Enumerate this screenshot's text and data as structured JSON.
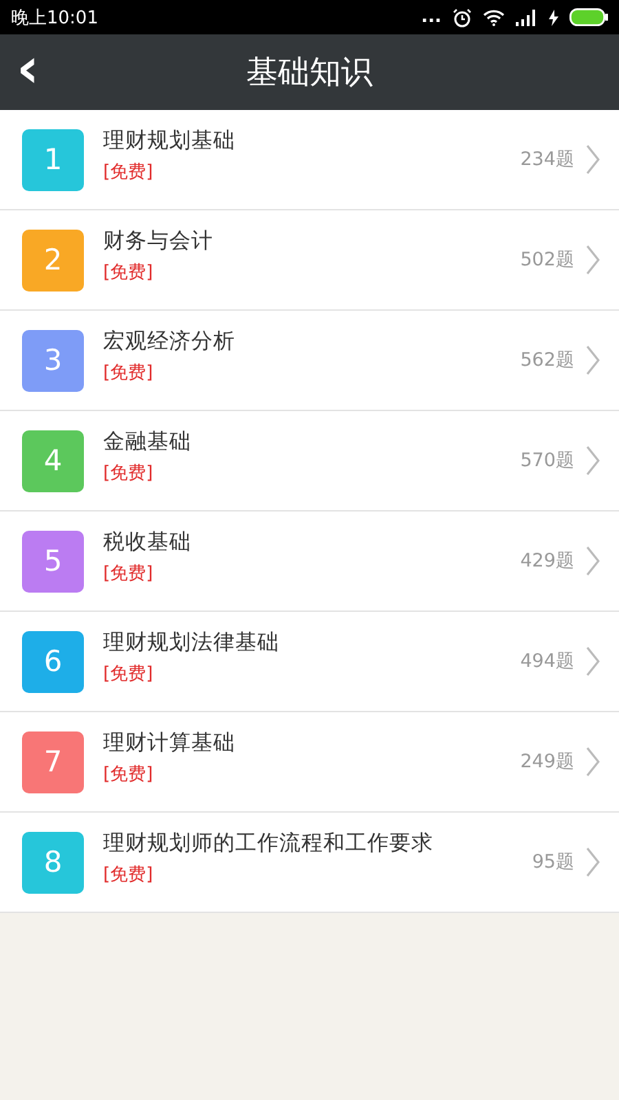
{
  "status_bar": {
    "time": "晚上10:01",
    "more": "..."
  },
  "header": {
    "back": "‹",
    "title": "基础知识"
  },
  "chapters": [
    {
      "number": "1",
      "title": "理财规划基础",
      "tag": "[免费]",
      "count": "234题",
      "color": "#26c6da"
    },
    {
      "number": "2",
      "title": "财务与会计",
      "tag": "[免费]",
      "count": "502题",
      "color": "#f9a825"
    },
    {
      "number": "3",
      "title": "宏观经济分析",
      "tag": "[免费]",
      "count": "562题",
      "color": "#7e9cf7"
    },
    {
      "number": "4",
      "title": "金融基础",
      "tag": "[免费]",
      "count": "570题",
      "color": "#5cc85c"
    },
    {
      "number": "5",
      "title": "税收基础",
      "tag": "[免费]",
      "count": "429题",
      "color": "#bb7cf2"
    },
    {
      "number": "6",
      "title": "理财规划法律基础",
      "tag": "[免费]",
      "count": "494题",
      "color": "#1eaee8"
    },
    {
      "number": "7",
      "title": "理财计算基础",
      "tag": "[免费]",
      "count": "249题",
      "color": "#f87676"
    },
    {
      "number": "8",
      "title": "理财规划师的工作流程和工作要求",
      "tag": "[免费]",
      "count": "95题",
      "color": "#26c6da"
    }
  ]
}
